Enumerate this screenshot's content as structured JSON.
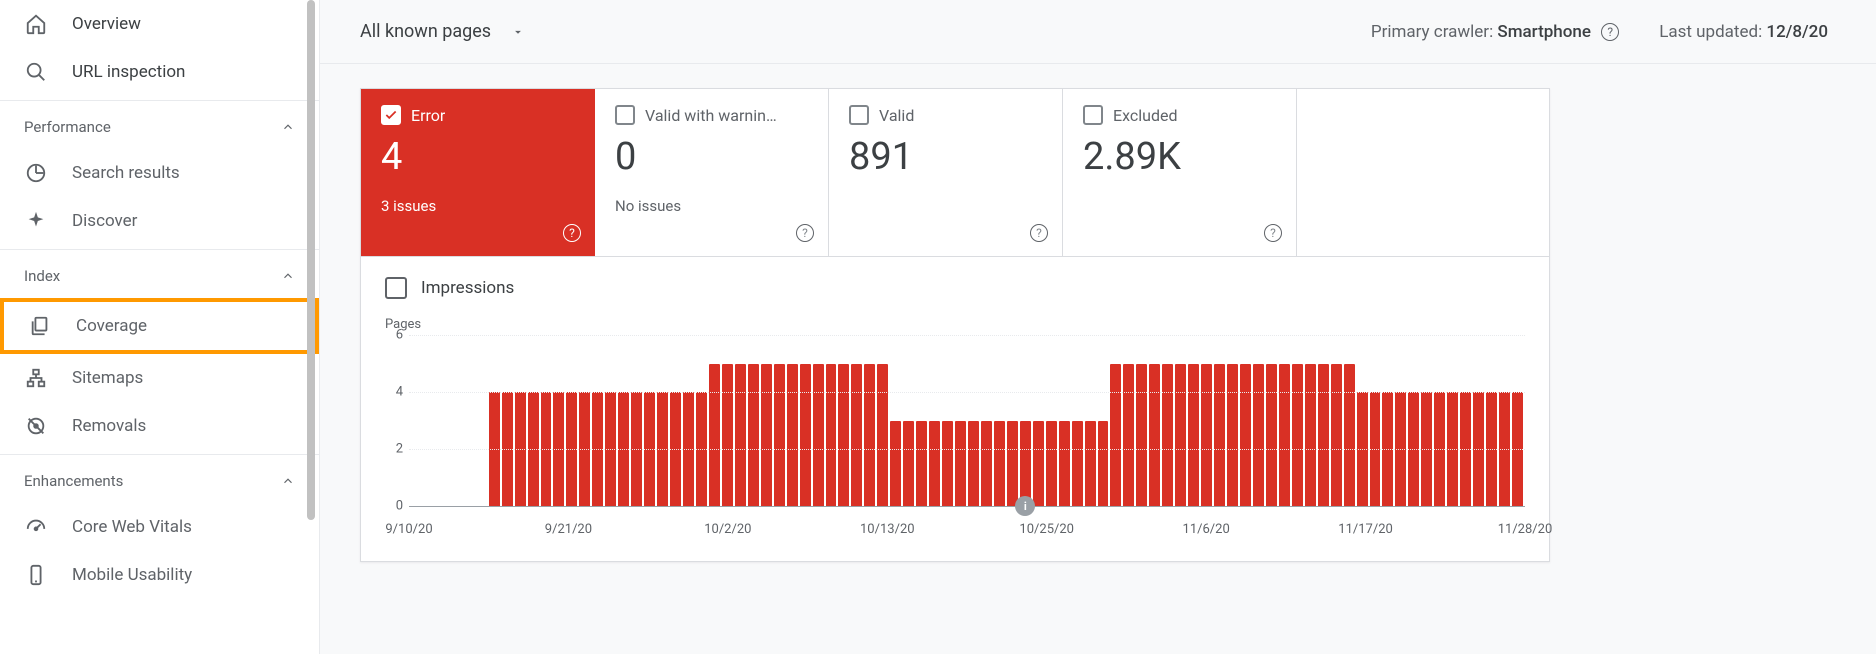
{
  "sidebar": {
    "items": [
      {
        "label": "Overview",
        "icon": "home-icon"
      },
      {
        "label": "URL inspection",
        "icon": "search-icon"
      }
    ],
    "sections": [
      {
        "title": "Performance",
        "items": [
          {
            "label": "Search results",
            "icon": "google-icon"
          },
          {
            "label": "Discover",
            "icon": "sparkle-icon"
          }
        ]
      },
      {
        "title": "Index",
        "items": [
          {
            "label": "Coverage",
            "icon": "pages-icon",
            "highlighted": true
          },
          {
            "label": "Sitemaps",
            "icon": "sitemap-icon"
          },
          {
            "label": "Removals",
            "icon": "removal-icon"
          }
        ]
      },
      {
        "title": "Enhancements",
        "items": [
          {
            "label": "Core Web Vitals",
            "icon": "gauge-icon"
          },
          {
            "label": "Mobile Usability",
            "icon": "phone-icon"
          }
        ]
      }
    ]
  },
  "topbar": {
    "filter_label": "All known pages",
    "crawler_label": "Primary crawler:",
    "crawler_value": "Smartphone",
    "updated_label": "Last updated:",
    "updated_value": "12/8/20"
  },
  "stats": [
    {
      "label": "Error",
      "value": "4",
      "sub": "3 issues",
      "selected": true
    },
    {
      "label": "Valid with warnin…",
      "value": "0",
      "sub": "No issues",
      "selected": false
    },
    {
      "label": "Valid",
      "value": "891",
      "sub": "",
      "selected": false
    },
    {
      "label": "Excluded",
      "value": "2.89K",
      "sub": "",
      "selected": false
    }
  ],
  "impressions_label": "Impressions",
  "chart_data": {
    "type": "bar",
    "title": "",
    "ylabel": "Pages",
    "xlabel": "",
    "ylim": [
      0,
      6
    ],
    "y_ticks": [
      0,
      2,
      4,
      6
    ],
    "x_ticks": [
      "9/10/20",
      "9/21/20",
      "10/2/20",
      "10/13/20",
      "10/25/20",
      "11/6/20",
      "11/17/20",
      "11/28/20"
    ],
    "values": [
      0,
      0,
      0,
      0,
      0,
      0,
      4,
      4,
      4,
      4,
      4,
      4,
      4,
      4,
      4,
      4,
      4,
      4,
      4,
      4,
      4,
      4,
      4,
      5,
      5,
      5,
      5,
      5,
      5,
      5,
      5,
      5,
      5,
      5,
      5,
      5,
      5,
      3,
      3,
      3,
      3,
      3,
      3,
      3,
      3,
      3,
      3,
      3,
      3,
      3,
      3,
      3,
      3,
      3,
      5,
      5,
      5,
      5,
      5,
      5,
      5,
      5,
      5,
      5,
      5,
      5,
      5,
      5,
      5,
      5,
      5,
      5,
      5,
      4,
      4,
      4,
      4,
      4,
      4,
      4,
      4,
      4,
      4,
      4,
      4,
      4
    ],
    "marker_index": 47
  }
}
